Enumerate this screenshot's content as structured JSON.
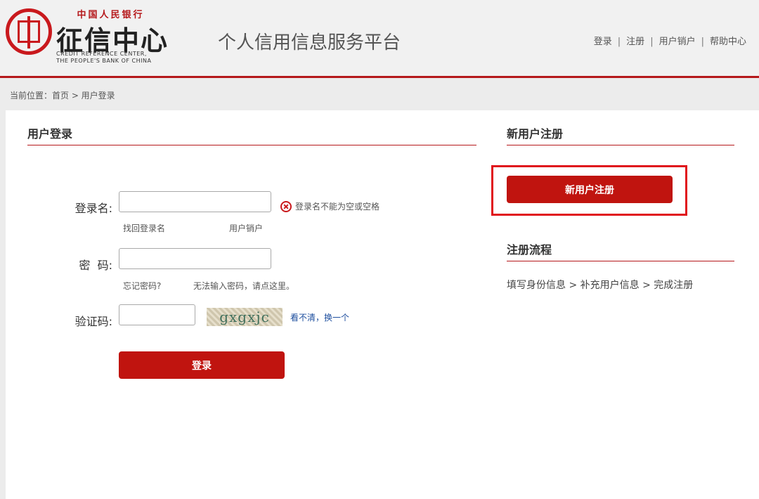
{
  "header": {
    "logo_top": "中国人民银行",
    "logo_main": "征信中心",
    "logo_en_line1": "CREDIT REFERENCE CENTER,",
    "logo_en_line2": "THE PEOPLE'S BANK OF CHINA",
    "platform_title": "个人信用信息服务平台",
    "nav": [
      "登录",
      "注册",
      "用户销户",
      "帮助中心"
    ]
  },
  "breadcrumb": "当前位置：首页 > 用户登录",
  "login": {
    "title": "用户登录",
    "username_label": "登录名:",
    "username_value": "",
    "username_error": "登录名不能为空或空格",
    "find_username": "找回登录名",
    "cancel_account": "用户销户",
    "password_label": "密  码:",
    "password_value": "",
    "forgot_password": "忘记密码?",
    "cannot_input": "无法输入密码，请点这里。",
    "captcha_label": "验证码:",
    "captcha_value": "",
    "captcha_text": "gxgxjc",
    "refresh_captcha": "看不清，换一个",
    "submit_label": "登录"
  },
  "register": {
    "title": "新用户注册",
    "button_label": "新用户注册",
    "flow_title": "注册流程",
    "flow_steps": "填写身份信息 > 补充用户信息 > 完成注册"
  },
  "colors": {
    "brand_red": "#b5181b",
    "button_red": "#c0140f",
    "highlight": "#e0141c",
    "link_blue": "#1d4e9e"
  }
}
